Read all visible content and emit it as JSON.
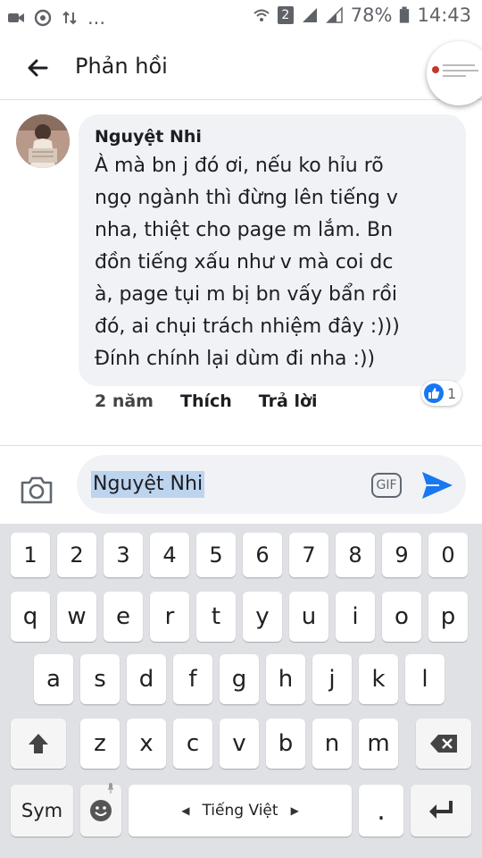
{
  "status_bar": {
    "sim": "2",
    "battery": "78%",
    "time": "14:43",
    "more": "..."
  },
  "header": {
    "title": "Phản hồi"
  },
  "comment": {
    "author": "Nguyệt Nhi",
    "lines": [
      "À mà bn j đó ơi, nếu ko hỉu rõ",
      "ngọ ngành thì đừng lên tiếng v",
      "nha, thiệt cho page m lắm. Bn",
      "đồn tiếng xấu như v mà coi dc",
      "à, page tụi m bị bn vấy bẩn rồi",
      "đó, ai chụi trách nhiệm đây :)))",
      "Đính chính lại dùm đi nha :))"
    ],
    "time": "2 năm",
    "like_label": "Thích",
    "reply_label": "Trả lời",
    "reaction_count": "1"
  },
  "composer": {
    "value": "Nguyệt Nhi",
    "gif_label": "GIF"
  },
  "keyboard": {
    "row_numbers": [
      "1",
      "2",
      "3",
      "4",
      "5",
      "6",
      "7",
      "8",
      "9",
      "0"
    ],
    "row1": [
      "q",
      "w",
      "e",
      "r",
      "t",
      "y",
      "u",
      "i",
      "o",
      "p"
    ],
    "row2": [
      "a",
      "s",
      "d",
      "f",
      "g",
      "h",
      "j",
      "k",
      "l"
    ],
    "row3": [
      "z",
      "x",
      "c",
      "v",
      "b",
      "n",
      "m"
    ],
    "sym_label": "Sym",
    "space_label": "Tiếng Việt",
    "period_label": "."
  },
  "colors": {
    "accent": "#1877f2",
    "bubble": "#f0f2f5",
    "keyboard_bg": "#dfe1e5",
    "selection": "#bdd4ef"
  }
}
